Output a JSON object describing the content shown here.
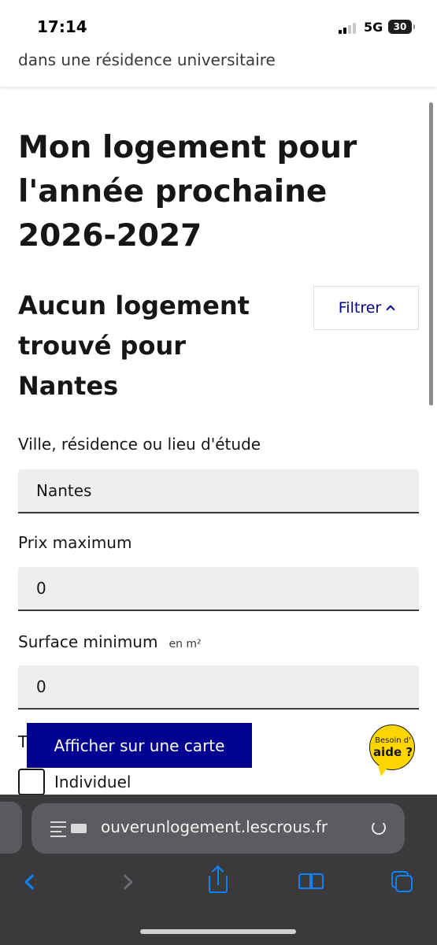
{
  "status_bar": {
    "time": "17:14",
    "network": "5G",
    "battery": "30"
  },
  "header": {
    "subtitle": "dans une résidence universitaire"
  },
  "main": {
    "page_title": "Mon logement pour l'année prochaine 2026-2027",
    "results_title": "Aucun logement trouvé pour Nantes",
    "filter_button": "Filtrer"
  },
  "filters": {
    "location_label": "Ville, résidence ou lieu d'étude",
    "location_value": "Nantes",
    "max_price_label": "Prix maximum",
    "max_price_value": "0",
    "min_surface_label": "Surface minimum",
    "min_surface_hint": "en m²",
    "min_surface_value": "0",
    "type_label_peek": "T",
    "type_option_individual": "Individuel"
  },
  "map_button": "Afficher sur une carte",
  "help": {
    "line1": "Besoin d'",
    "line2": "aide ?",
    "color": "#ffd500"
  },
  "browser": {
    "url": "ouverunlogement.lescrous.fr"
  },
  "colors": {
    "accent": "#000091",
    "ios_blue": "#0a84ff"
  },
  "icons": [
    "chevron-up-icon",
    "page-menu-icon",
    "extension-icon",
    "reload-icon",
    "back-chevron-icon",
    "forward-chevron-icon",
    "share-icon",
    "bookmarks-icon",
    "tabs-icon"
  ]
}
